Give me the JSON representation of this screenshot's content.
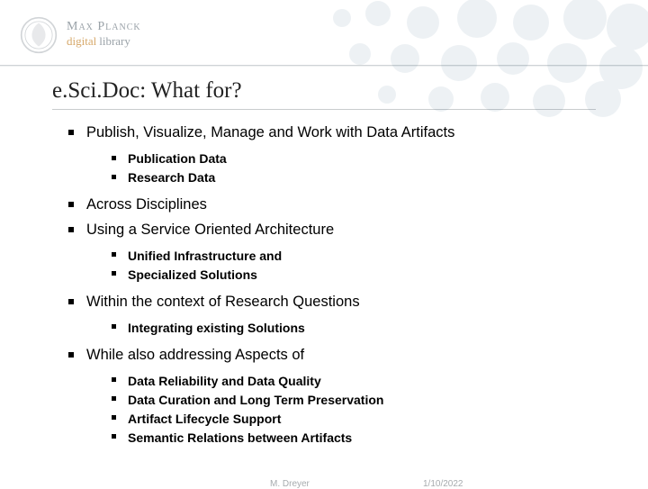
{
  "header": {
    "brand_line1": "Max Planck",
    "brand_line2a": "digital",
    "brand_line2b": "library"
  },
  "title": "e.Sci.Doc: What for?",
  "bullets": [
    {
      "text": "Publish, Visualize, Manage and Work with Data Artifacts",
      "sub": [
        "Publication Data",
        "Research Data"
      ]
    },
    {
      "text": "Across Disciplines",
      "sub": []
    },
    {
      "text": "Using a Service Oriented Architecture",
      "sub": [
        "Unified Infrastructure and",
        "Specialized Solutions"
      ]
    },
    {
      "text": "Within the context of Research Questions",
      "sub": [
        "Integrating existing Solutions"
      ]
    },
    {
      "text": "While also addressing Aspects of",
      "sub": [
        "Data Reliability and Data Quality",
        "Data Curation and Long Term Preservation",
        "Artifact Lifecycle Support",
        "Semantic Relations between Artifacts"
      ]
    }
  ],
  "footer": {
    "author": "M. Dreyer",
    "date": "1/10/2022"
  }
}
